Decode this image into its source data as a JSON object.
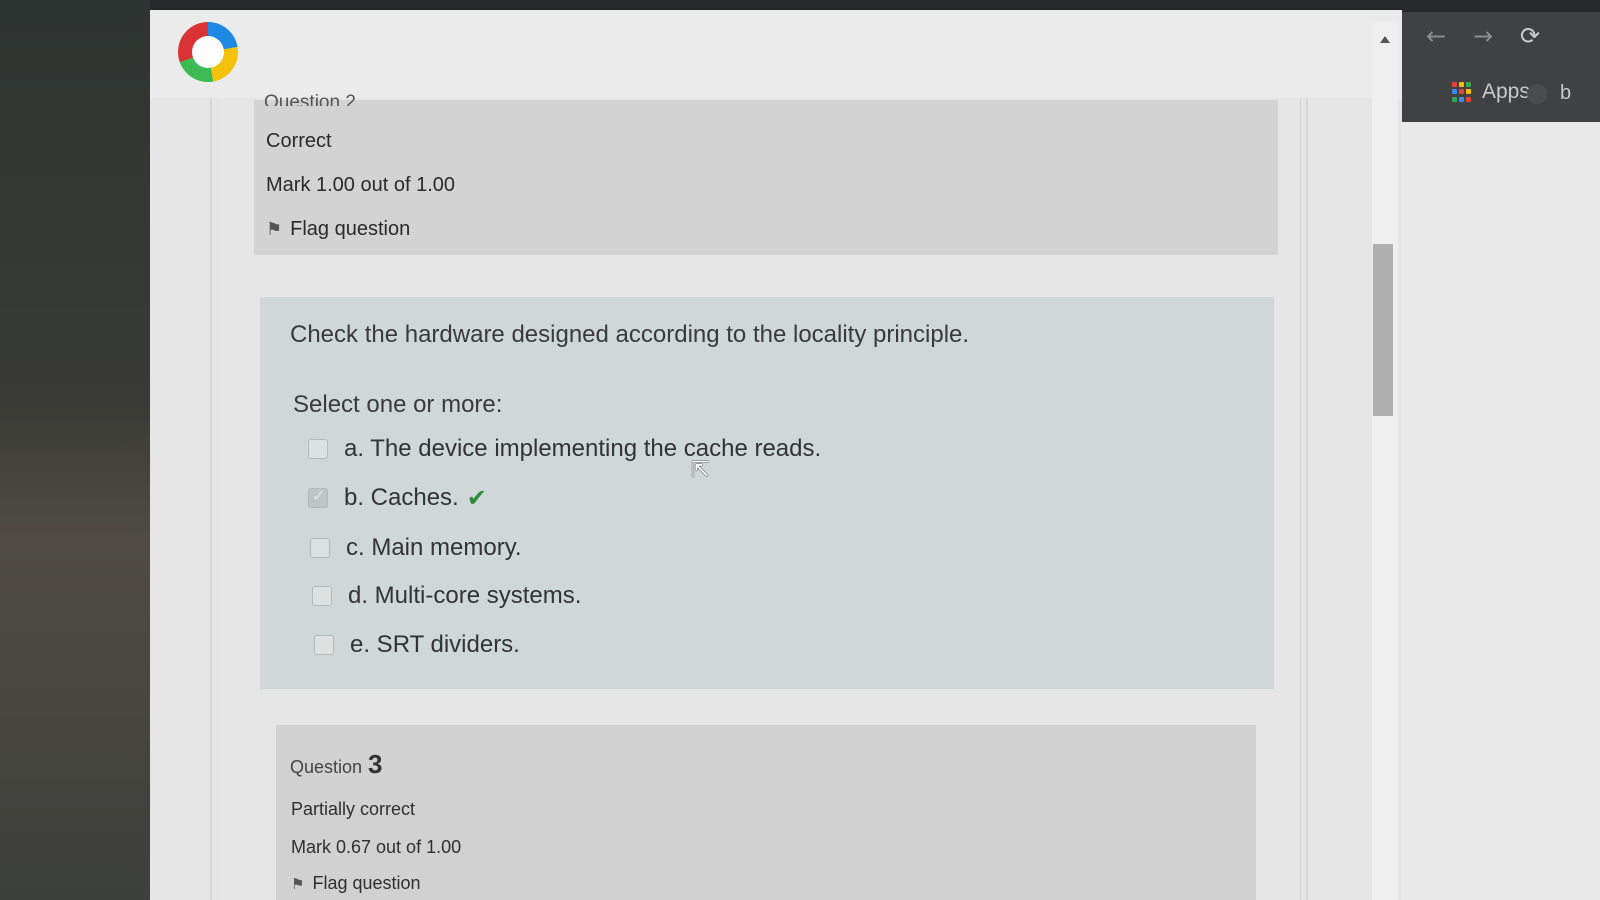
{
  "browser": {
    "back_icon": "arrow-left-icon",
    "forward_icon": "arrow-right-icon",
    "reload_icon": "reload-icon",
    "bookmarks_apps_label": "Apps",
    "bookmarks_extra": "b"
  },
  "question2": {
    "title": "Question 2",
    "status": "Correct",
    "mark": "Mark 1.00 out of 1.00",
    "flag_label": "Flag question",
    "text": "Check the hardware designed according to the locality principle.",
    "prompt": "Select one or more:",
    "options": [
      {
        "label": "a. The device implementing the cache reads.",
        "checked": false
      },
      {
        "label": "b. Caches.",
        "checked": true,
        "correct": true
      },
      {
        "label": "c. Main memory.",
        "checked": false
      },
      {
        "label": "d. Multi-core systems.",
        "checked": false
      },
      {
        "label": "e. SRT dividers.",
        "checked": false
      }
    ]
  },
  "question3": {
    "title_prefix": "Question",
    "number": "3",
    "status": "Partially correct",
    "mark": "Mark 0.67 out of 1.00",
    "flag_label": "Flag question"
  },
  "colors": {
    "correct_check": "#2e8b3d",
    "question_bg": "#cfd8d7",
    "info_bg": "#d3d3d3"
  }
}
